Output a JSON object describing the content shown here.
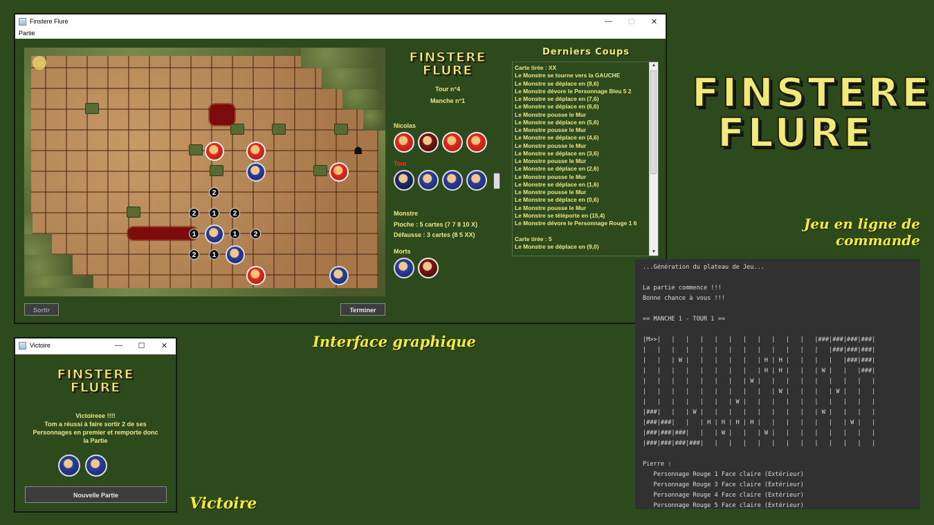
{
  "main_window": {
    "title": "Finstere Flure",
    "menu_partie": "Partie",
    "minimize": "—",
    "maximize": "☐",
    "close": "✕",
    "logo_line1": "FINSTERE",
    "logo_line2": "FLURE",
    "tour": "Tour n°4",
    "manche": "Manche n°1",
    "player1": "Nicolas",
    "player2": "Tom",
    "monstre_label": "Monstre",
    "pioche": "Pioche : 5 cartes (7 7 8 10 X)",
    "defausse": "Défausse : 3 cartes (8 5 XX)",
    "morts_label": "Morts",
    "btn_sortir": "Sortir",
    "btn_terminer": "Terminer",
    "board_numbers": [
      "2",
      "2",
      "1",
      "2",
      "1",
      "1",
      "2",
      "2",
      "1"
    ],
    "coups_title": "Derniers Coups",
    "log": [
      "Carte tirée : XX",
      "Le Monstre se tourne vers la GAUCHE",
      "Le Monstre se déplace en (8,6)",
      "Le Monstre dévore le Personnage Bleu 5 2",
      "Le Monstre se déplace en (7,6)",
      "Le Monstre se déplace en (6,6)",
      "Le Monstre pousse le Mur",
      "Le Monstre se déplace en (5,6)",
      "Le Monstre pousse le Mur",
      "Le Monstre se déplace en (4,6)",
      "Le Monstre pousse le Mur",
      "Le Monstre se déplace en (3,6)",
      "Le Monstre pousse le Mur",
      "Le Monstre se déplace en (2,6)",
      "Le Monstre pousse le Mur",
      "Le Monstre se déplace en (1,6)",
      "Le Monstre pousse le Mur",
      "Le Monstre se déplace en (0,6)",
      "Le Monstre pousse le Mur",
      "Le Monstre se téléporte en (15,4)",
      "Le Monstre dévore le Personnage Rouge 1 6",
      "",
      "Carte tirée : 5",
      "Le Monstre se déplace en (9,0)"
    ],
    "scroll_up": "▲",
    "scroll_down": "▼"
  },
  "victory_window": {
    "title": "Victoire",
    "minimize": "—",
    "maximize": "☐",
    "close": "✕",
    "logo_line1": "FINSTERE",
    "logo_line2": "FLURE",
    "line1": "Victoireee !!!!",
    "line2": "Tom a réussi à faire sortir 2 de ses",
    "line3": "Personnages en premier et remporte donc",
    "line4": "la Partie",
    "btn_nouvelle": "Nouvelle Partie"
  },
  "captions": {
    "gui": "Interface graphique",
    "victoire": "Victoire",
    "cmd_line1": "Jeu en ligne de",
    "cmd_line2": "commande"
  },
  "big_logo": {
    "line1": "FINSTERE",
    "line2": "FLURE"
  },
  "terminal": {
    "lines": [
      "...Génération du plateau de Jeu...",
      "",
      "La partie commence !!!",
      "Bonne chance à vous !!!",
      "",
      "== MANCHE 1 - TOUR 1 ==",
      "",
      "|M>>|   |   |   |   |   |   |   |   |   |   |   |###|###|###|###|",
      "|   |   |   |   |   |   |   |   |   |   |   |   |   |###|###|###|",
      "|   |   | W |   |   |   |   |   | H | H |   |   |   |   |###|###|",
      "|   |   |   |   |   |   |   |   | H | H |   |   | W |   |   |###|",
      "|   |   |   |   |   |   |   | W |   |   |   |   |   |   |   |   |",
      "|   |   |   |   |   |   |   |   |   | W |   |   |   | W |   |   |",
      "|   |   |   |   |   |   | W |   |   |   |   |   |   |   |   |   |",
      "|###|   |   | W |   |   |   |   |   |   |   |   | W |   |   |   |",
      "|###|###|   |   | H | H | H | H |   |   |   |   |   |   | W |   |",
      "|###|###|###|   |   | W |   |   | W |   |   |   |   |   |   |   |",
      "|###|###|###|###|   |   |   |   |   |   |   |   |   |   |   |   |",
      "",
      "Pierre :",
      "   Personnage Rouge 1 Face claire (Extérieur)",
      "   Personnage Rouge 3 Face claire (Extérieur)",
      "   Personnage Rouge 4 Face claire (Extérieur)",
      "   Personnage Rouge 5 Face claire (Extérieur)"
    ]
  },
  "colors": {
    "background": "#2d4a1c",
    "text_yellow": "#efe88a",
    "caption_yellow": "#f4ea3f",
    "player_red": "#e23b2b",
    "terminal_bg": "#313131"
  }
}
